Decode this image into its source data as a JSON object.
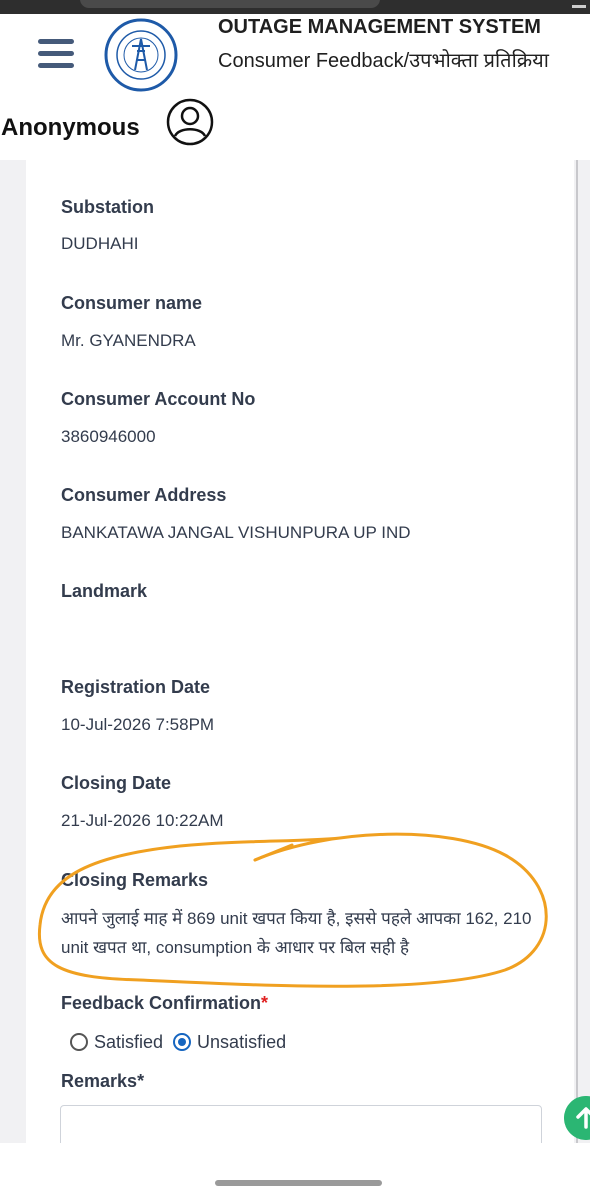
{
  "header": {
    "app_title": "OUTAGE MANAGEMENT SYSTEM",
    "app_subtitle": "Consumer Feedback/उपभोक्ता प्रतिक्रिया",
    "user_name": "Anonymous"
  },
  "fields": {
    "substation": {
      "label": "Substation",
      "value": "DUDHAHI"
    },
    "consumer_name": {
      "label": "Consumer name",
      "value": "Mr. GYANENDRA"
    },
    "account_no": {
      "label": "Consumer Account No",
      "value": "3860946000"
    },
    "address": {
      "label": "Consumer Address",
      "value": "BANKATAWA JANGAL VISHUNPURA UP IND"
    },
    "landmark": {
      "label": "Landmark",
      "value": ""
    },
    "registration_date": {
      "label": "Registration Date",
      "value": "10-Jul-2026 7:58PM"
    },
    "closing_date": {
      "label": "Closing Date",
      "value": "21-Jul-2026 10:22AM"
    },
    "closing_remarks": {
      "label": "Closing Remarks",
      "value": "आपने जुलाई माह में 869 unit खपत किया है, इससे पहले आपका 162, 210 unit खपत था, consumption के आधार पर बिल सही है"
    }
  },
  "feedback": {
    "label": "Feedback Confirmation",
    "required_mark": "*",
    "options": [
      {
        "label": "Satisfied",
        "selected": false
      },
      {
        "label": "Unsatisfied",
        "selected": true
      }
    ]
  },
  "remarks": {
    "label": "Remarks",
    "required_mark": "*",
    "value": ""
  },
  "colors": {
    "label_text": "#333c4d",
    "radio_selected": "#1565c0",
    "annotation": "#f0a020",
    "fab": "#2bb673"
  }
}
